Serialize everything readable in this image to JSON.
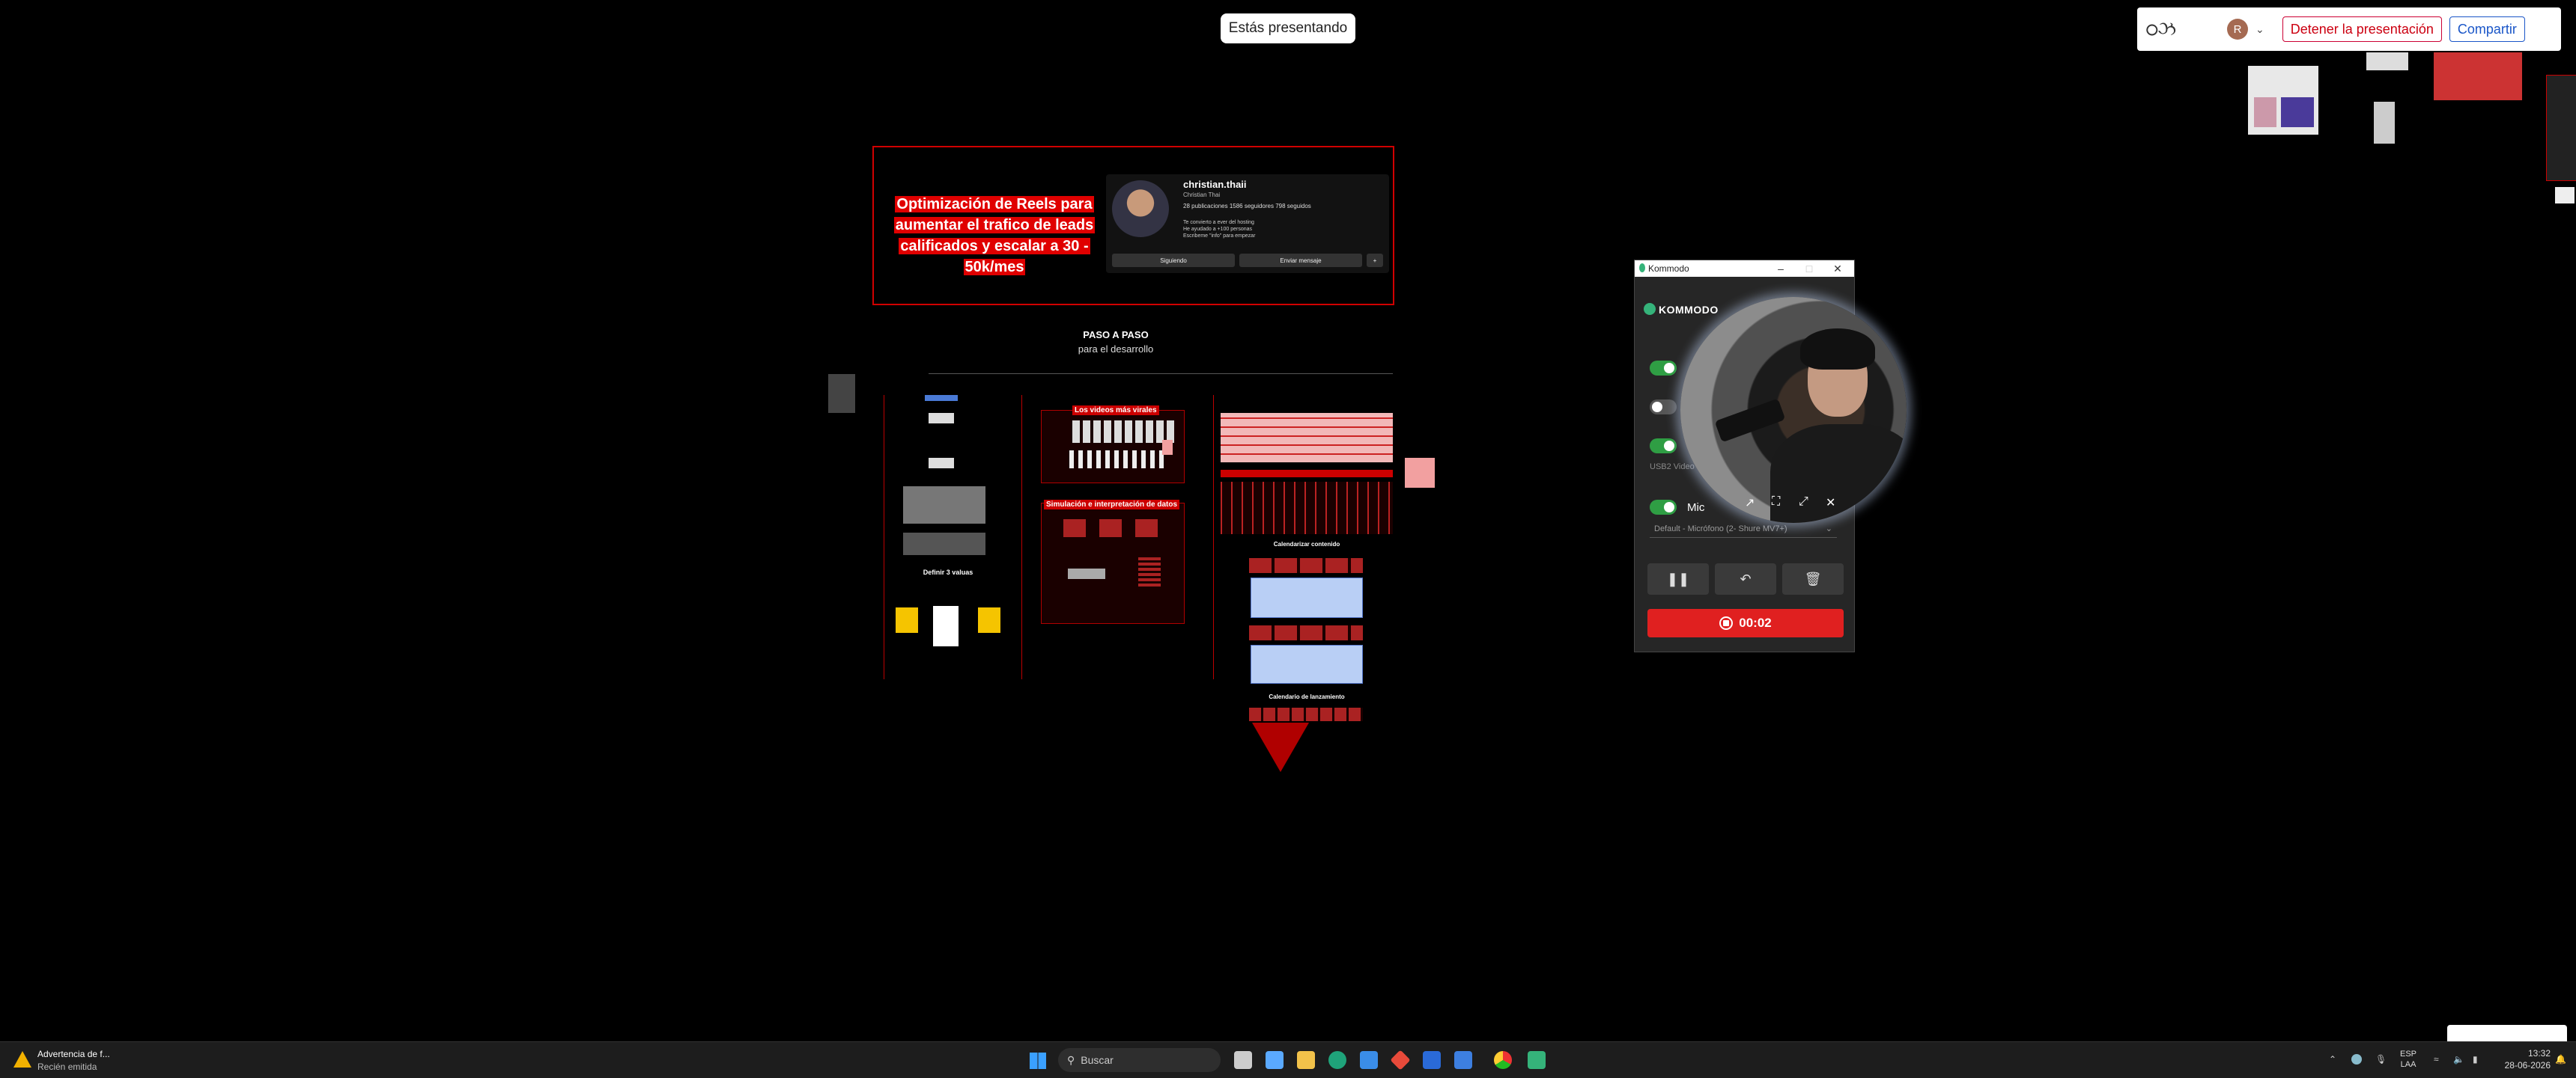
{
  "presenting_banner": "Estás presentando",
  "toolbar": {
    "logo_text": "ഠઝ",
    "avatar_initial": "R",
    "stop_label": "Detener la presentación",
    "share_label": "Compartir"
  },
  "canvas": {
    "headline": "Optimización de Reels para aumentar el trafico de leads calificados y escalar a 30 - 50k/mes",
    "instagram_profile": {
      "username": "christian.thaii",
      "display_name": "Christian Thai",
      "stats": "28 publicaciones   1586 seguidores   798 seguidos",
      "bio_lines": [
        "Te convierto a ever del hosting",
        "He ayudado a +100 personas",
        "Escribeme \"info\" para empezar"
      ],
      "following_button": "Siguiendo",
      "message_button": "Enviar mensaje"
    },
    "step_title": "PASO A PASO",
    "step_subtitle": "para el desarrollo",
    "section_labels": {
      "viral_videos": "Los videos más virales",
      "simulation": "Simulación e interpretación de datos",
      "define_values": "Definir 3 valuas",
      "calendar_content": "Calendarizar contenido",
      "calendar_launch": "Calendario de lanzamiento"
    }
  },
  "kommo": {
    "window_title": "Kommodo",
    "brand": "KOMMODO",
    "camera_source": "USB2 Video",
    "mic_label": "Mic",
    "mic_device": "Default - Micrófono (2- Shure MV7+)",
    "timer": "00:02",
    "toggles": [
      true,
      false,
      true,
      true
    ]
  },
  "taskbar": {
    "notification_title": "Advertencia de f...",
    "notification_sub": "Recién emitida",
    "search_placeholder": "Buscar",
    "lang_line1": "ESP",
    "lang_line2": "LAA",
    "time": "13:32",
    "date": "28-06-2026"
  },
  "colors": {
    "accent_red": "#e00000",
    "kommo_green": "#2f9e44",
    "record_red": "#e02020",
    "share_blue": "#1a56c8"
  }
}
